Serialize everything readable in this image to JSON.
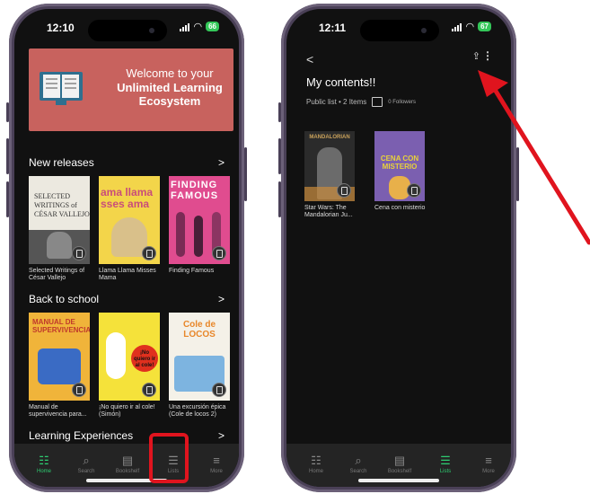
{
  "left_phone": {
    "status": {
      "time": "12:10",
      "battery": "66"
    },
    "banner": {
      "line1": "Welcome to your",
      "line2": "Unlimited Learning Ecosystem"
    },
    "sections": [
      {
        "title": "New releases",
        "chevron": ">",
        "books": [
          {
            "caption": "Selected Writings of César Vallejo",
            "cover_text": "SELECTED WRITINGS of CÉSAR VALLEJO",
            "colors": [
              "#ece9e0",
              "#333333"
            ]
          },
          {
            "caption": "Llama Llama Misses Mama",
            "cover_text": "ama llama sses ama",
            "colors": [
              "#f3d54a",
              "#c94d7a"
            ]
          },
          {
            "caption": "Finding Famous",
            "cover_text": "FINDING FAMOUS",
            "colors": [
              "#e04c8f",
              "#ffffff"
            ]
          }
        ]
      },
      {
        "title": "Back to school",
        "chevron": ">",
        "books": [
          {
            "caption": "Manual de supervivencia para...",
            "cover_text": "MANUAL DE SUPERVIVENCIA",
            "colors": [
              "#f0b43a",
              "#3a6bc4"
            ]
          },
          {
            "caption": "¡No quiero ir al cole! (Simón)",
            "cover_text": "¡No quiero ir al cole!",
            "colors": [
              "#f5e23a",
              "#e0301e"
            ]
          },
          {
            "caption": "Una excursión épica (Cole de locos 2)",
            "cover_text": "Cole de LOCOS",
            "colors": [
              "#f4f1e8",
              "#e8872a"
            ]
          }
        ]
      },
      {
        "title": "Learning Experiences",
        "chevron": ">"
      }
    ],
    "nav": [
      {
        "label": "Home",
        "icon": "grid-icon",
        "glyph": "☷",
        "active": true
      },
      {
        "label": "Search",
        "icon": "search-icon",
        "glyph": "⌕",
        "active": false
      },
      {
        "label": "Bookshelf",
        "icon": "bookshelf-icon",
        "glyph": "▤",
        "active": false
      },
      {
        "label": "Lists",
        "icon": "lists-icon",
        "glyph": "☰",
        "active": false
      },
      {
        "label": "More",
        "icon": "menu-icon",
        "glyph": "≡",
        "active": false
      }
    ]
  },
  "right_phone": {
    "status": {
      "time": "12:11",
      "battery": "67"
    },
    "back": "<",
    "title": "My contents!!",
    "meta": {
      "text": "Public list • 2 Items",
      "followers": "0 Followers"
    },
    "books": [
      {
        "caption": "Star Wars: The Mandalorian Ju...",
        "cover_text": "MANDALORIAN",
        "colors": [
          "#2b2b2b",
          "#c9a15a"
        ]
      },
      {
        "caption": "Cena con misterio",
        "cover_text": "CENA CON MISTERIO",
        "colors": [
          "#7b5fb0",
          "#e8d23a"
        ]
      }
    ],
    "nav": [
      {
        "label": "Home",
        "icon": "grid-icon",
        "glyph": "☷",
        "active": false
      },
      {
        "label": "Search",
        "icon": "search-icon",
        "glyph": "⌕",
        "active": false
      },
      {
        "label": "Bookshelf",
        "icon": "bookshelf-icon",
        "glyph": "▤",
        "active": false
      },
      {
        "label": "Lists",
        "icon": "lists-icon",
        "glyph": "☰",
        "active": true
      },
      {
        "label": "More",
        "icon": "menu-icon",
        "glyph": "≡",
        "active": false
      }
    ]
  },
  "annotations": {
    "highlight_color": "#e0141e",
    "arrow_color": "#e0141e"
  }
}
